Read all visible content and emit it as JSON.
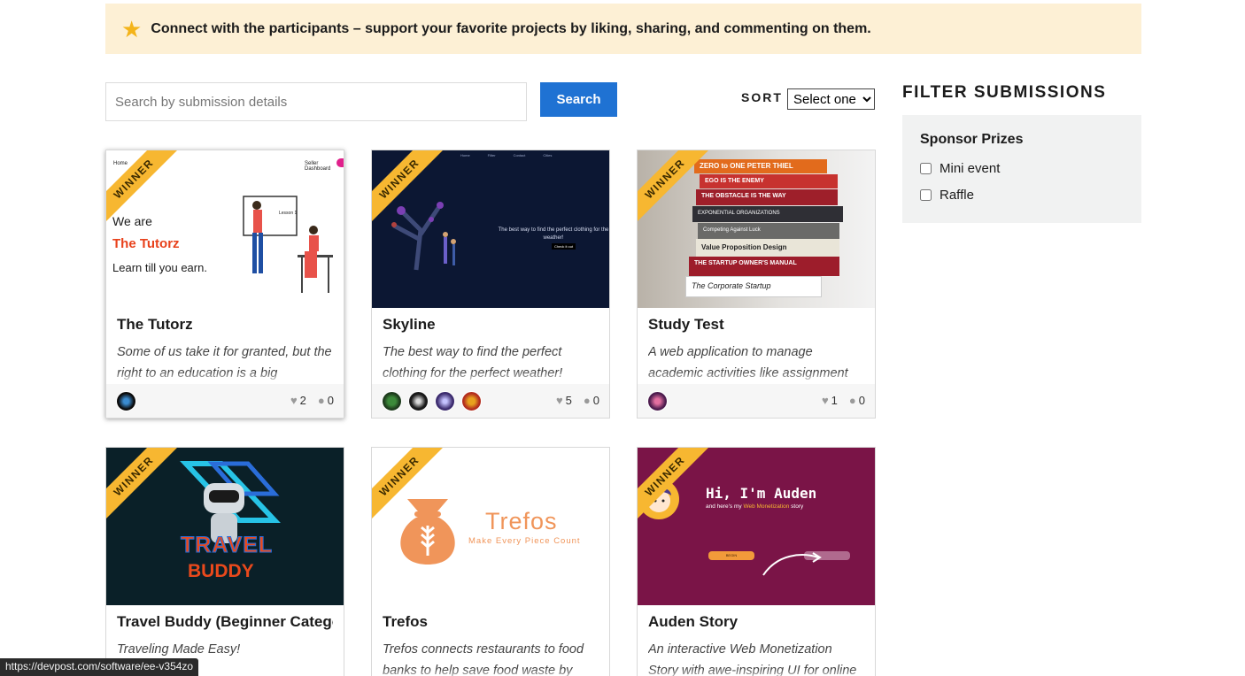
{
  "banner": {
    "icon": "star-icon",
    "message": "Connect with the participants – support your favorite projects by liking, sharing, and commenting on them."
  },
  "search": {
    "placeholder": "Search by submission details",
    "button_label": "Search"
  },
  "sort": {
    "label": "SORT",
    "selected": "Select one"
  },
  "filter": {
    "title": "FILTER SUBMISSIONS",
    "group_title": "Sponsor Prizes",
    "options": [
      {
        "label": "Mini event",
        "checked": false
      },
      {
        "label": "Raffle",
        "checked": false
      }
    ]
  },
  "ribbon_label": "WINNER",
  "cards": [
    {
      "title": "The Tutorz",
      "tagline": "Some of us take it for granted, but the right to an education is a big",
      "likes": "2",
      "comments": "0",
      "thumb": {
        "nav_left": "Home",
        "nav_right": "Seller Dashboard",
        "line1": "We are",
        "line2": "The Tutorz",
        "line3": "Learn till you earn.",
        "board": "Lesson 1"
      }
    },
    {
      "title": "Skyline",
      "tagline": "The best way to find the perfect clothing for the perfect weather!",
      "likes": "5",
      "comments": "0",
      "thumb": {
        "nav": [
          "Home",
          "Filter",
          "Contact",
          "Cities"
        ],
        "text": "The best way to find the perfect clothing for the weather!",
        "button": "Check it out"
      }
    },
    {
      "title": "Study Test",
      "tagline": "A web application to manage academic activities like assignment",
      "likes": "1",
      "comments": "0",
      "thumb": {
        "books": [
          "ZERO to ONE  PETER THIEL",
          "EGO IS THE ENEMY",
          "THE OBSTACLE IS THE WAY",
          "EXPONENTIAL ORGANIZATIONS",
          "Competing Against Luck",
          "Value Proposition Design",
          "THE STARTUP OWNER'S MANUAL",
          "The Corporate Startup"
        ]
      }
    },
    {
      "title": "Travel Buddy (Beginner Category)",
      "tagline": "Traveling Made Easy!",
      "thumb": {
        "line1": "TRAVEL",
        "line2": "BUDDY"
      }
    },
    {
      "title": "Trefos",
      "tagline": "Trefos connects restaurants to food banks to help save food waste by",
      "thumb": {
        "name": "Trefos",
        "slogan": "Make Every Piece Count"
      }
    },
    {
      "title": "Auden Story",
      "tagline": "An interactive Web Monetization Story with awe-inspiring UI for online",
      "thumb": {
        "heading": "Hi, I'm Auden",
        "sub_prefix": "and here's my",
        "sub_highlight": "Web Monetization",
        "sub_suffix": "story",
        "tag": "BEGIN"
      }
    }
  ],
  "status_url": "https://devpost.com/software/ee-v354zo",
  "colors": {
    "accent": "#1f72d3",
    "banner_bg": "#fdf0d5",
    "ribbon": "#f7b731"
  }
}
